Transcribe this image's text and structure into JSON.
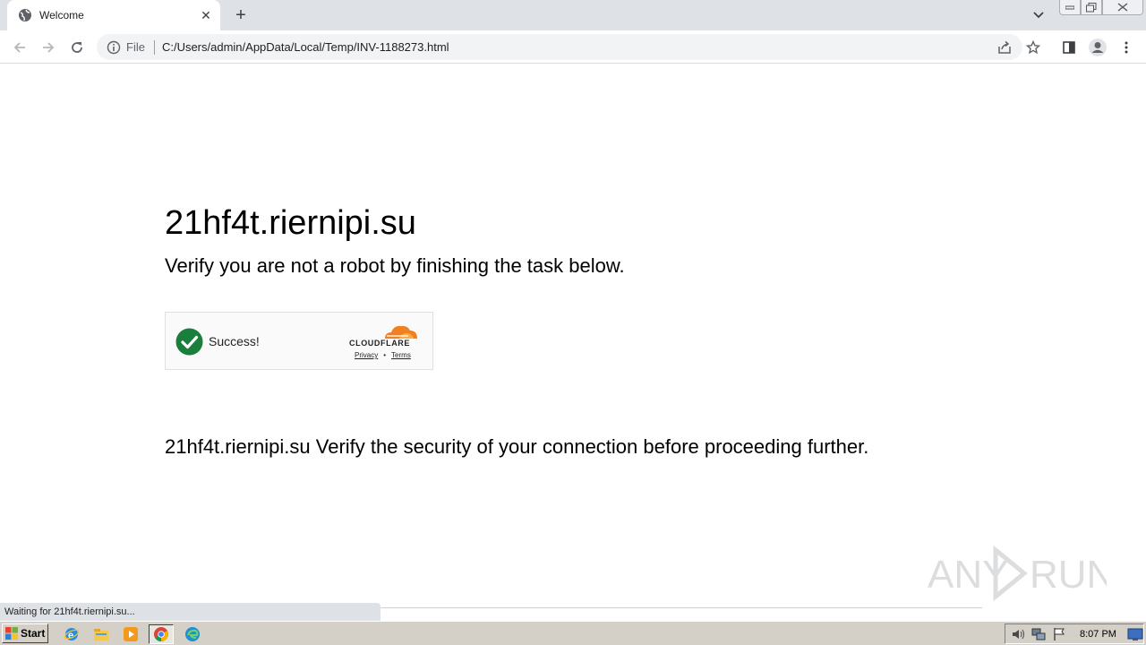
{
  "browser": {
    "tab_title": "Welcome",
    "url_scheme_label": "File",
    "url": "C:/Users/admin/AppData/Local/Temp/INV-1188273.html",
    "status_text": "Waiting for 21hf4t.riernipi.su..."
  },
  "page": {
    "heading": "21hf4t.riernipi.su",
    "subheading": "Verify you are not a robot by finishing the task below.",
    "widget": {
      "status": "Success!",
      "brand": "CLOUDFLARE",
      "privacy_link": "Privacy",
      "separator": "•",
      "terms_link": "Terms",
      "check_color": "#1a7f3c",
      "brand_color": "#f38020"
    },
    "message": "21hf4t.riernipi.su Verify the security of your connection before proceeding further.",
    "watermark": "ANY RUN"
  },
  "taskbar": {
    "start_label": "Start",
    "clock": "8:07 PM",
    "apps": [
      "internet-explorer-icon",
      "file-explorer-icon",
      "media-player-icon",
      "chrome-icon",
      "edge-icon"
    ]
  }
}
